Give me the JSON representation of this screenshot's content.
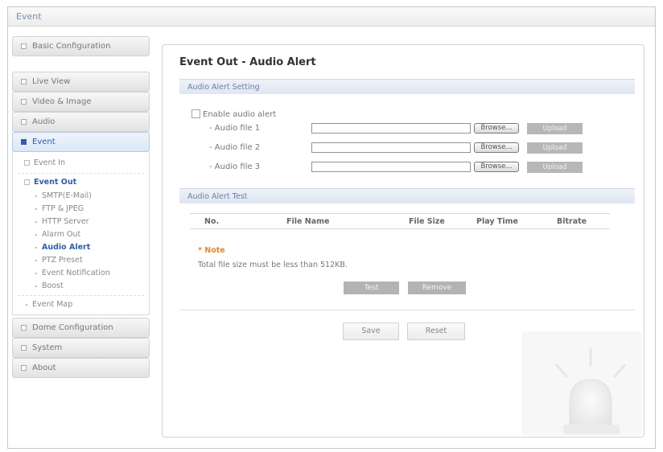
{
  "window": {
    "title": "Event"
  },
  "sidebar": {
    "menus_top": [
      {
        "label": "Basic Configuration"
      },
      {
        "label": "Live View"
      },
      {
        "label": "Video & Image"
      },
      {
        "label": "Audio"
      },
      {
        "label": "Event"
      }
    ],
    "event_in": "Event In",
    "event_out": "Event Out",
    "event_out_items": [
      {
        "label": "SMTP(E-Mail)"
      },
      {
        "label": "FTP & JPEG"
      },
      {
        "label": "HTTP Server"
      },
      {
        "label": "Alarm Out"
      },
      {
        "label": "Audio Alert"
      },
      {
        "label": "PTZ Preset"
      },
      {
        "label": "Event Notification"
      },
      {
        "label": "Boost"
      }
    ],
    "event_map": "Event Map",
    "menus_bottom": [
      {
        "label": "Dome Configuration"
      },
      {
        "label": "System"
      },
      {
        "label": "About"
      }
    ]
  },
  "content": {
    "title": "Event Out - Audio Alert",
    "setting_section": "Audio Alert Setting",
    "enable_label": "Enable audio alert",
    "files": [
      {
        "label": "- Audio file 1",
        "value": ""
      },
      {
        "label": "- Audio file 2",
        "value": ""
      },
      {
        "label": "- Audio file 3",
        "value": ""
      }
    ],
    "browse_label": "Browse...",
    "upload_label": "Upload",
    "test_section": "Audio Alert Test",
    "table_headers": [
      "No.",
      "File Name",
      "File Size",
      "Play Time",
      "Bitrate"
    ],
    "note_title": "* Note",
    "note_text": "Total file size must be less than 512KB.",
    "test_label": "Test",
    "remove_label": "Remove",
    "save_label": "Save",
    "reset_label": "Reset"
  }
}
